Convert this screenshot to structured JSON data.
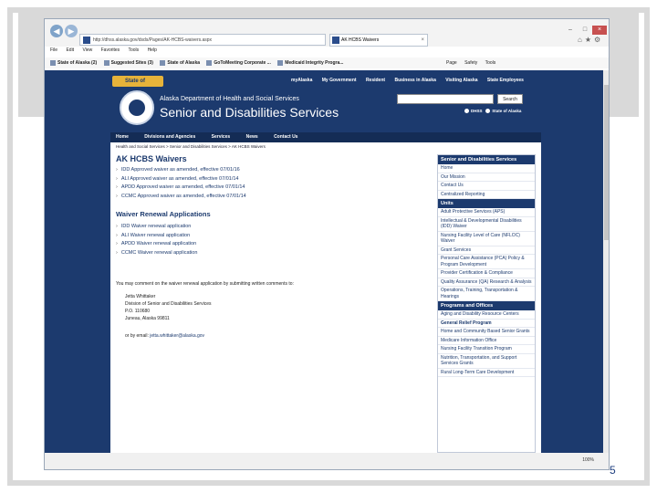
{
  "slide": {
    "number": "5"
  },
  "browser": {
    "address": "http://dhss.alaska.gov/dsds/Pages/AK-HCBS-waivers.aspx",
    "tab_title": "AK HCBS Waivers",
    "menu": [
      "File",
      "Edit",
      "View",
      "Favorites",
      "Tools",
      "Help"
    ],
    "favorites": [
      "State of Alaska (2)",
      "Suggested Sites (3)",
      "State of Alaska",
      "GoToMeeting Corporate ...",
      "Medicaid Integrity Progra..."
    ],
    "commands": [
      "Page",
      "Safety",
      "Tools"
    ],
    "zoom": "100%"
  },
  "site": {
    "state_logo": "State of Alaska",
    "util_links": [
      "myAlaska",
      "My Government",
      "Resident",
      "Business in Alaska",
      "Visiting Alaska",
      "State Employees"
    ],
    "dept_name": "Alaska Department of Health and Social Services",
    "division_name": "Senior and Disabilities Services",
    "search_label": "Search",
    "radio_options": [
      "DHSS",
      "State of Alaska"
    ],
    "nav": [
      "Home",
      "Divisions and Agencies",
      "Services",
      "News",
      "Contact Us"
    ],
    "breadcrumb": "Health and Social Services  >  Senior and Disabilities Services  >  AK HCBS Waivers",
    "page_title": "AK HCBS Waivers",
    "approved_waivers": [
      "IDD Approved waiver as amended, effective 07/01/16",
      "ALI Approved waiver as amended, effective 07/01/14",
      "APDD Approved waiver as amended, effective 07/01/14",
      "CCMC Approved waiver as amended, effective 07/01/14"
    ],
    "renewal_title": "Waiver Renewal Applications",
    "renewal_apps": [
      "IDD Waiver renewal application",
      "ALI Waiver renewal application",
      "APDD Waiver renewal application",
      "CCMC Waiver renewal application"
    ],
    "comment_text": "You may comment on the waiver renewal application by submitting written comments to:",
    "address": [
      "Jetta Whittaker",
      "Division of Senior and Disabilities Services",
      "P.O. 110680",
      "Juneau, Alaska  99811"
    ],
    "email_prefix": "or by email:",
    "email": "jetta.whittaker@alaska.gov",
    "sidebar": {
      "head1": "Senior and Disabilities Services",
      "group1": [
        "Home",
        "Our Mission",
        "Contact Us",
        "Centralized Reporting"
      ],
      "head2": "Units",
      "group2": [
        "Adult Protective Services (APS)",
        "Intellectual & Developmental Disabilities (IDD) Waiver",
        "Nursing Facility Level of Care (NFLOC) Waiver",
        "Grant Services",
        "Personal Care Assistance (PCA) Policy & Program Development",
        "Provider Certification & Compliance",
        "Quality Assurance (QA) Research & Analysis",
        "Operations, Training, Transportation & Hearings"
      ],
      "head3": "Programs and Offices",
      "group3": [
        "Aging and Disability Resource Centers",
        "General Relief Program",
        "Home and Community Based Senior Grants",
        "Medicare Information Office",
        "Nursing Facility Transition Program",
        "Nutrition, Transportation, and Support Services Grants",
        "Rural Long-Term Care Development"
      ]
    }
  }
}
